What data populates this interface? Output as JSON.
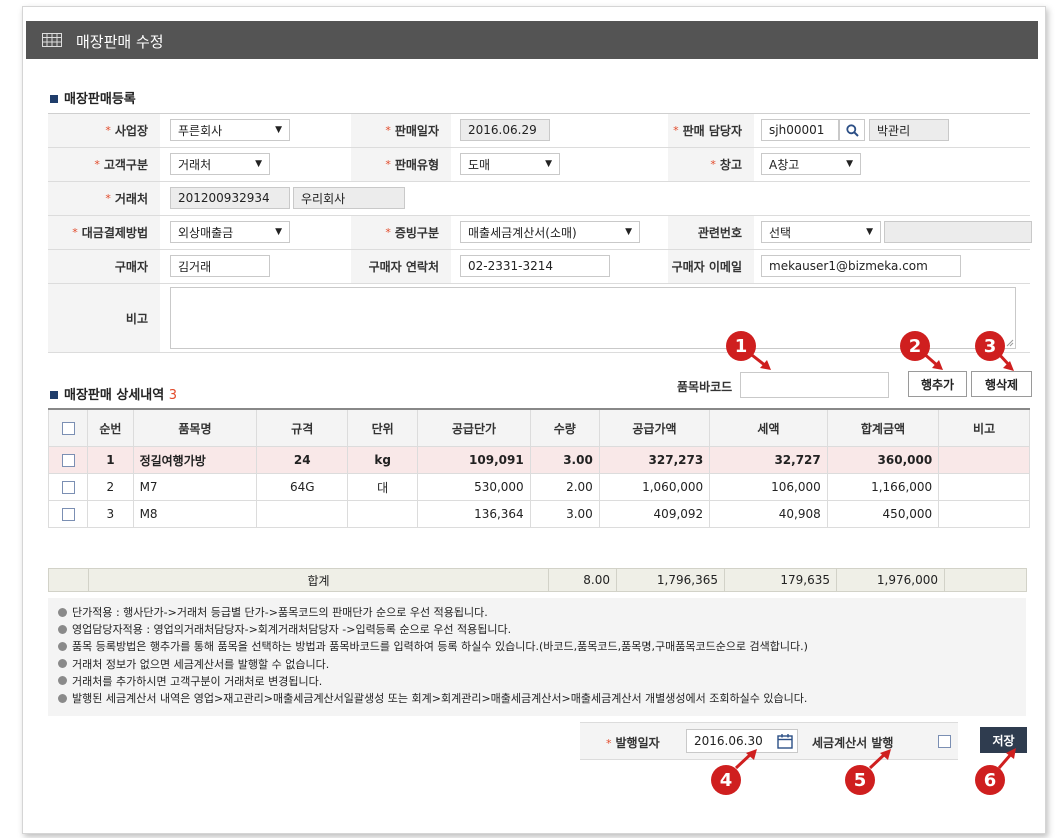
{
  "window": {
    "title": "매장판매 수정"
  },
  "form": {
    "section_title": "매장판매등록",
    "business_label": "사업장",
    "business_value": "푸른회사",
    "sale_date_label": "판매일자",
    "sale_date_value": "2016.06.29",
    "sales_rep_label": "판매 담당자",
    "sales_rep_id": "sjh00001",
    "sales_rep_name": "박관리",
    "customer_type_label": "고객구분",
    "customer_type_value": "거래처",
    "sale_type_label": "판매유형",
    "sale_type_value": "도매",
    "warehouse_label": "창고",
    "warehouse_value": "A창고",
    "client_label": "거래처",
    "client_code": "201200932934",
    "client_name": "우리회사",
    "payment_label": "대금결제방법",
    "payment_value": "외상매출금",
    "evidence_label": "증빙구분",
    "evidence_value": "매출세금계산서(소매)",
    "related_label": "관련번호",
    "related_value": "선택",
    "buyer_label": "구매자",
    "buyer_value": "김거래",
    "buyer_phone_label": "구매자 연락처",
    "buyer_phone_value": "02-2331-3214",
    "buyer_email_label": "구매자 이메일",
    "buyer_email_value": "mekauser1@bizmeka.com",
    "remarks_label": "비고",
    "required_mark": "*"
  },
  "detail": {
    "section_title": "매장판매 상세내역",
    "count": "3",
    "barcode_label": "품목바코드",
    "add_row_label": "행추가",
    "delete_row_label": "행삭제",
    "columns": [
      "순번",
      "품목명",
      "규격",
      "단위",
      "공급단가",
      "수량",
      "공급가액",
      "세액",
      "합계금액",
      "비고"
    ],
    "rows": [
      {
        "no": "1",
        "name": "정길여행가방",
        "spec": "24",
        "unit": "kg",
        "price": "109,091",
        "qty": "3.00",
        "supply": "327,273",
        "tax": "32,727",
        "total": "360,000",
        "note": ""
      },
      {
        "no": "2",
        "name": "M7",
        "spec": "64G",
        "unit": "대",
        "price": "530,000",
        "qty": "2.00",
        "supply": "1,060,000",
        "tax": "106,000",
        "total": "1,166,000",
        "note": ""
      },
      {
        "no": "3",
        "name": "M8",
        "spec": "",
        "unit": "",
        "price": "136,364",
        "qty": "3.00",
        "supply": "409,092",
        "tax": "40,908",
        "total": "450,000",
        "note": ""
      }
    ],
    "sum": {
      "label": "합계",
      "qty": "8.00",
      "supply": "1,796,365",
      "tax": "179,635",
      "total": "1,976,000"
    }
  },
  "notes": [
    "단가적용 : 행사단가->거래처 등급별 단가->품목코드의 판매단가 순으로 우선 적용됩니다.",
    "영업담당자적용 : 영업의거래처담당자->회계거래처담당자 ->입력등록 순으로 우선 적용됩니다.",
    "품목 등록방법은 행추가를 통해 품목을 선택하는 방법과 품목바코드를 입력하여 등록 하실수 있습니다.(바코드,품목코드,품목명,구매품목코드순으로 검색합니다.)",
    "거래처 정보가 없으면 세금계산서를 발행할 수 없습니다.",
    "거래처를 추가하시면 고객구분이 거래처로 변경됩니다.",
    "발행된 세금계산서 내역은 영업>재고관리>매출세금계산서일괄생성 또는 회계>회계관리>매출세금계산서>매출세금계산서 개별생성에서 조회하실수 있습니다."
  ],
  "footer": {
    "issue_date_label": "발행일자",
    "issue_date_value": "2016.06.30",
    "tax_invoice_label": "세금계산서 발행",
    "save_label": "저장"
  },
  "callouts": [
    "1",
    "2",
    "3",
    "4",
    "5",
    "6"
  ],
  "colors": {
    "titlebar": "#545454",
    "badge": "#cf1f1f",
    "save_button": "#2f3c4f",
    "highlight_row": "#f9e8e8",
    "count": "#e24a2a"
  }
}
